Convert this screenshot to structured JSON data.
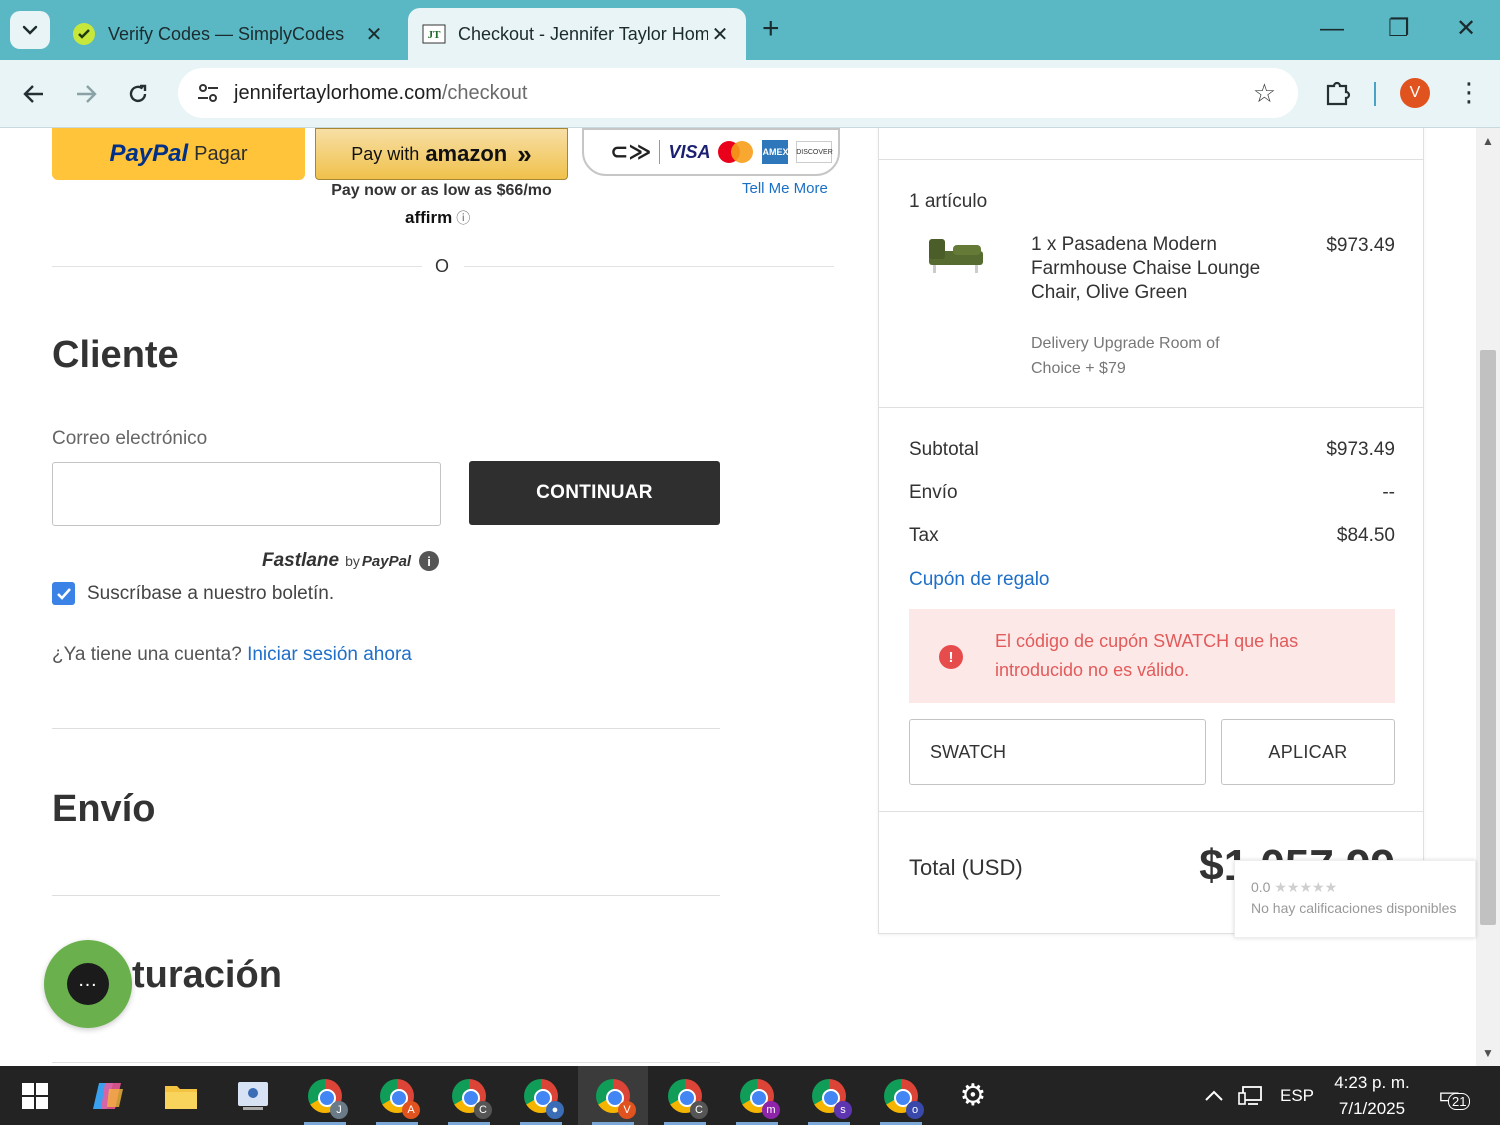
{
  "browser": {
    "tabs": [
      {
        "title": "Verify Codes — SimplyCodes",
        "active": false
      },
      {
        "title": "Checkout - Jennifer Taylor Hom",
        "active": true
      }
    ],
    "url_domain": "jennifertaylorhome.com",
    "url_path": "/checkout",
    "profile_initial": "V"
  },
  "express": {
    "paypal_logo": "PayPal",
    "paypal_label": "Pagar",
    "amazon_label": "Pay with",
    "amazon_brand": "amazon",
    "amazon_sub": "Pay now or as low as $66/mo",
    "affirm": "affirm",
    "cards": [
      "VISA",
      "AMEX",
      "DISCOVER"
    ],
    "tell_more": "Tell Me More",
    "or": "O"
  },
  "customer": {
    "title": "Cliente",
    "email_label": "Correo electrónico",
    "email_value": "",
    "continue": "CONTINUAR",
    "fastlane": "Fastlane",
    "fastlane_by": "by",
    "fastlane_paypal": "PayPal",
    "newsletter": "Suscríbase a nuestro boletín.",
    "newsletter_checked": true,
    "account_q": "¿Ya tiene una cuenta?",
    "signin": "Iniciar sesión ahora"
  },
  "shipping": {
    "title": "Envío"
  },
  "billing": {
    "title_partial": "turación"
  },
  "summary": {
    "items_count": "1 artículo",
    "product": {
      "name": "1 x Pasadena Modern Farmhouse Chaise Lounge Chair, Olive Green",
      "option": "Delivery Upgrade Room of Choice + $79",
      "price": "$973.49"
    },
    "subtotal_label": "Subtotal",
    "subtotal": "$973.49",
    "shipping_label": "Envío",
    "shipping": "--",
    "tax_label": "Tax",
    "tax": "$84.50",
    "coupon_link": "Cupón de regalo",
    "coupon_error": "El código de cupón SWATCH que has introducido no es válido.",
    "coupon_value": "SWATCH",
    "apply": "APLICAR",
    "total_label": "Total (USD)",
    "total": "$1,057.99"
  },
  "rating": {
    "score": "0.0",
    "stars": "★★★★★",
    "text": "No hay calificaciones disponibles"
  },
  "taskbar": {
    "chrome_badges": [
      "J",
      "A",
      "C",
      "",
      "V",
      "C",
      "m",
      "s",
      "o"
    ],
    "language": "ESP",
    "time": "4:23 p. m.",
    "date": "7/1/2025",
    "notifications": "21"
  },
  "colors": {
    "chrome_frame": "#5ab8c4",
    "toolbar": "#e8f4f6",
    "link_blue": "#1f6fc8",
    "error_bg": "#fde8e8",
    "error_text": "#e25a5a",
    "dark_button": "#2f2f2f",
    "chat_green": "#6ab04c"
  }
}
